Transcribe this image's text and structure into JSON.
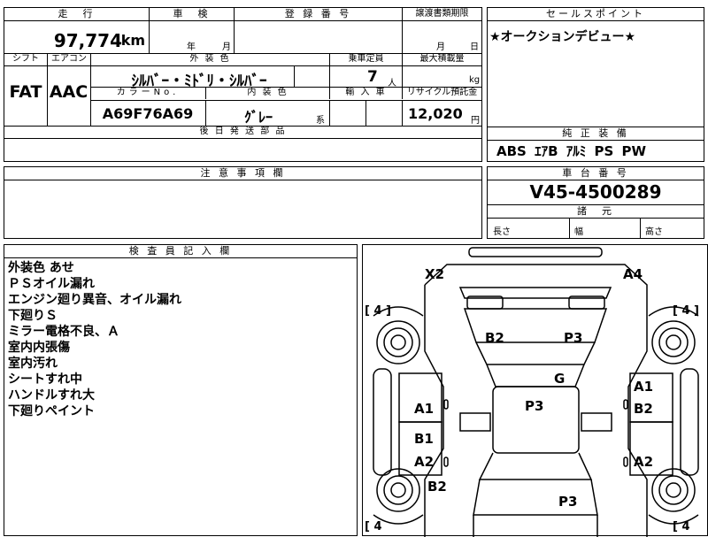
{
  "top_left": {
    "headers": {
      "mileage": "走　行",
      "inspection": "車　検",
      "registration": "登 録 番 号",
      "transfer_deadline": "譲渡書類期限"
    },
    "mileage_value": "97,774",
    "mileage_unit": "km",
    "inspection_year": "年",
    "inspection_month": "月",
    "transfer_month": "月",
    "transfer_day": "日",
    "shift_label": "シフト",
    "ac_label": "エアコン",
    "exterior_color_label": "外 装 色",
    "capacity_label": "乗車定員",
    "max_load_label": "最大積載量",
    "shift_value": "FAT",
    "ac_value": "AAC",
    "exterior_color_value": "ｼﾙﾊﾞｰ・ﾐﾄﾞﾘ・ｼﾙﾊﾞｰ",
    "capacity_value": "7",
    "capacity_unit": "人",
    "load_unit": "kg",
    "color_no_label": "カラーNo.",
    "interior_color_label": "内 装 色",
    "import_label": "輸 入 車",
    "recycle_label": "リサイクル預託金",
    "color_no_value": "A69F76A69",
    "interior_color_value": "ｸﾞﾚｰ",
    "interior_color_suffix": "系",
    "recycle_value": "12,020",
    "recycle_unit": "円",
    "later_parts_label": "後 日 発 送 部 品"
  },
  "sales_point": {
    "header": "セールスポイント",
    "text": "★オークションデビュー★"
  },
  "genuine_equipment": {
    "header": "純 正 装 備",
    "text": "ABS ｴｱB ｱﾙﾐ PS PW"
  },
  "caution": {
    "header": "注 意 事 項 欄"
  },
  "chassis": {
    "header": "車 台 番 号",
    "value": "V45-4500289"
  },
  "specs": {
    "header": "諸　元",
    "length": "長さ",
    "width": "幅",
    "height": "高さ"
  },
  "inspector": {
    "header": "検 査 員 記 入 欄",
    "notes": [
      "外装色 あせ",
      "ＰＳオイル漏れ",
      "エンジン廻り異音、オイル漏れ",
      "下廻りＳ",
      "ミラー電格不良、Ａ",
      "室内内張傷",
      "室内汚れ",
      "シートすれ中",
      "ハンドルすれ大",
      "下廻りペイント"
    ]
  },
  "diagram": {
    "marks": {
      "x2": "X2",
      "a4": "A4",
      "b2_top": "B2",
      "p3_top": "P3",
      "g": "G",
      "a1_left": "A1",
      "p3_center": "P3",
      "a1_right": "A1",
      "b2_right": "B2",
      "b1": "B1",
      "a2_left": "A2",
      "a2_right": "A2",
      "b2_bottom": "B2",
      "p3_bottom": "P3"
    },
    "tires": {
      "tl": "[ 4 ]",
      "tr": "[ 4 ]",
      "bl": "[ 4",
      "br": "[ 4"
    }
  }
}
